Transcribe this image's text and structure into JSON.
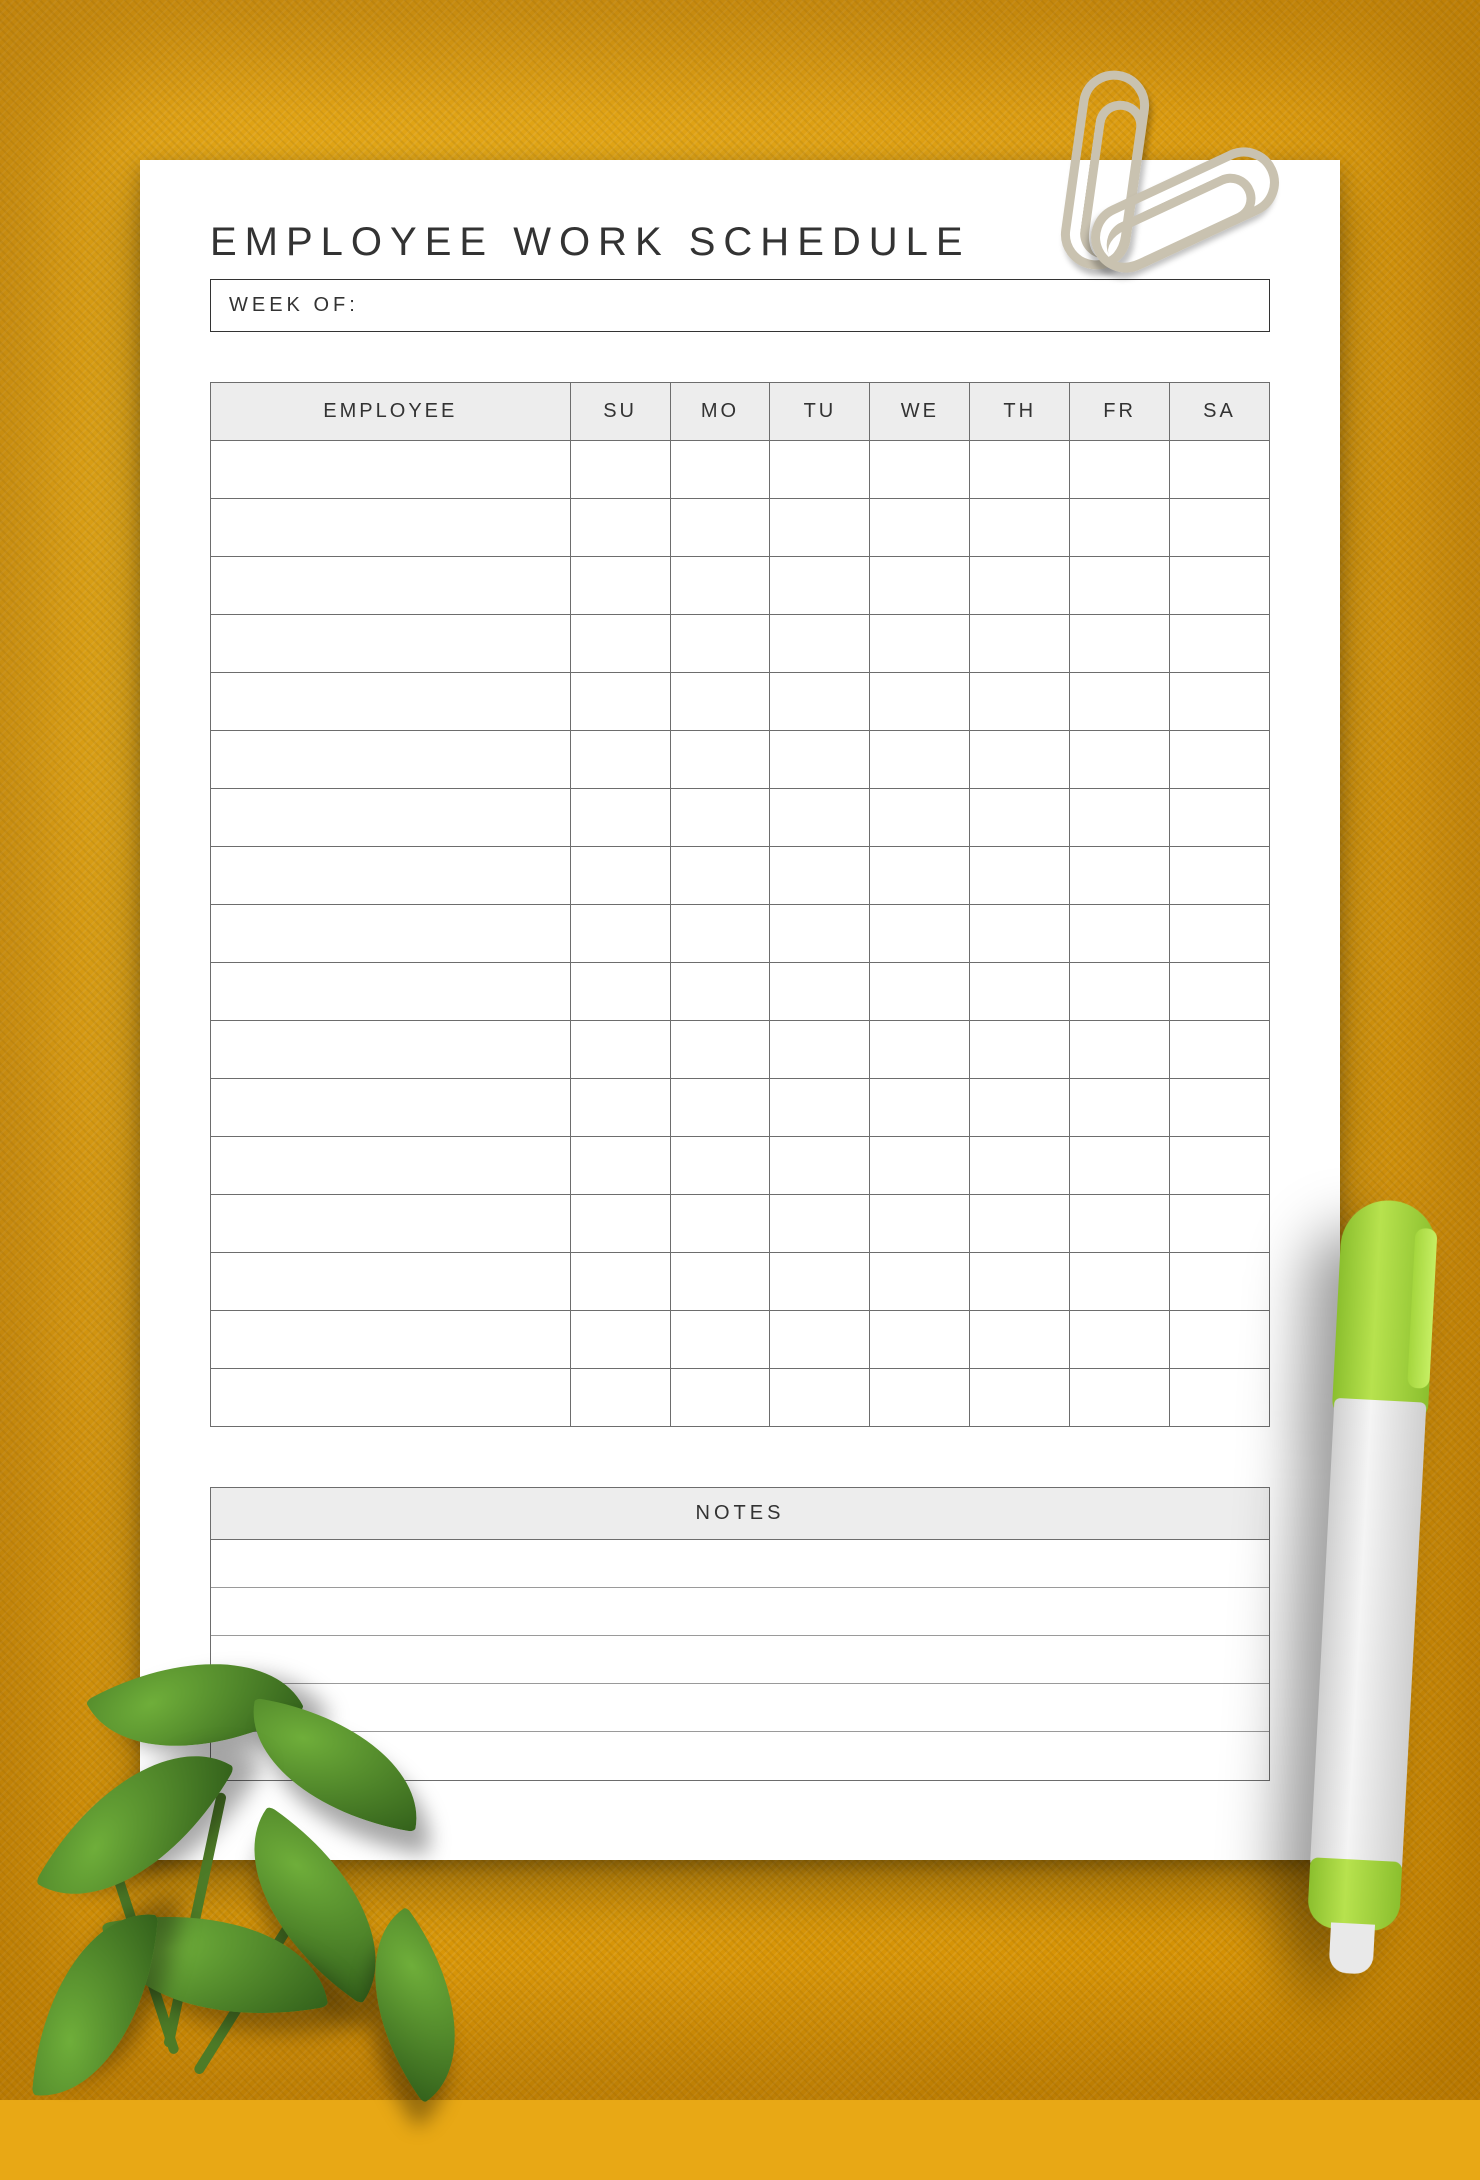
{
  "title": "EMPLOYEE WORK SCHEDULE",
  "week_of_label": "WEEK OF:",
  "week_of_value": "",
  "columns": {
    "employee": "EMPLOYEE",
    "days": [
      "SU",
      "MO",
      "TU",
      "WE",
      "TH",
      "FR",
      "SA"
    ]
  },
  "row_count": 17,
  "notes": {
    "header": "NOTES",
    "line_count": 5
  }
}
